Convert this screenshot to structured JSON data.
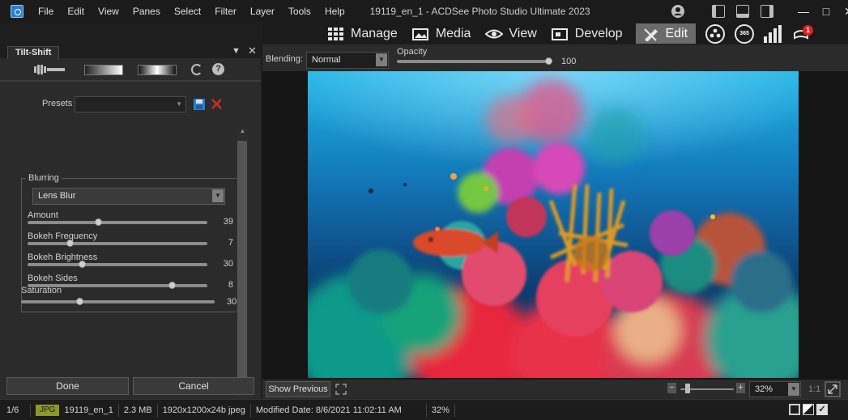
{
  "window": {
    "title": "19119_en_1 - ACDSee Photo Studio Ultimate 2023",
    "menu": [
      "File",
      "Edit",
      "View",
      "Panes",
      "Select",
      "Filter",
      "Layer",
      "Tools",
      "Help"
    ]
  },
  "modes": [
    {
      "label": "Manage",
      "icon": "grid-icon"
    },
    {
      "label": "Media",
      "icon": "photos-icon"
    },
    {
      "label": "View",
      "icon": "eye-icon"
    },
    {
      "label": "Develop",
      "icon": "develop-icon"
    },
    {
      "label": "Edit",
      "icon": "edit-icon",
      "active": true
    }
  ],
  "mode_extras": {
    "badge_365": "365",
    "notification_count": "1"
  },
  "panel": {
    "tab_label": "Tilt-Shift",
    "presets_label": "Presets",
    "presets_value": "",
    "blurring_label": "Blurring",
    "blur_type": "Lens Blur",
    "sliders": [
      {
        "label": "Amount",
        "value": 39,
        "max": 100
      },
      {
        "label": "Bokeh Frequency",
        "value": 7,
        "max": 30
      },
      {
        "label": "Bokeh Brightness",
        "value": 30,
        "max": 100
      },
      {
        "label": "Bokeh Sides",
        "value": 8,
        "max": 10
      }
    ],
    "saturation": {
      "label": "Saturation",
      "value": "30",
      "fraction": 0.3
    },
    "done_label": "Done",
    "cancel_label": "Cancel"
  },
  "options": {
    "blending_label": "Blending:",
    "blending_value": "Normal",
    "opacity_label": "Opacity",
    "opacity_value": "100",
    "opacity_fraction": 1.0
  },
  "viewbar": {
    "show_previous_label": "Show Previous",
    "zoom_value": "32%",
    "ratio_label": "1:1"
  },
  "status": {
    "index": "1/6",
    "format": "JPG",
    "filename": "19119_en_1",
    "size": "2.3 MB",
    "dimensions": "1920x1200x24b jpeg",
    "modified": "Modified Date: 8/6/2021 11:02:11 AM",
    "zoom": "32%"
  },
  "colors": {
    "accent_blue": "#2a7fd0",
    "delete_red": "#d02b2b",
    "notification_red": "#e02020",
    "jpg_badge": "#8a9a2a"
  }
}
